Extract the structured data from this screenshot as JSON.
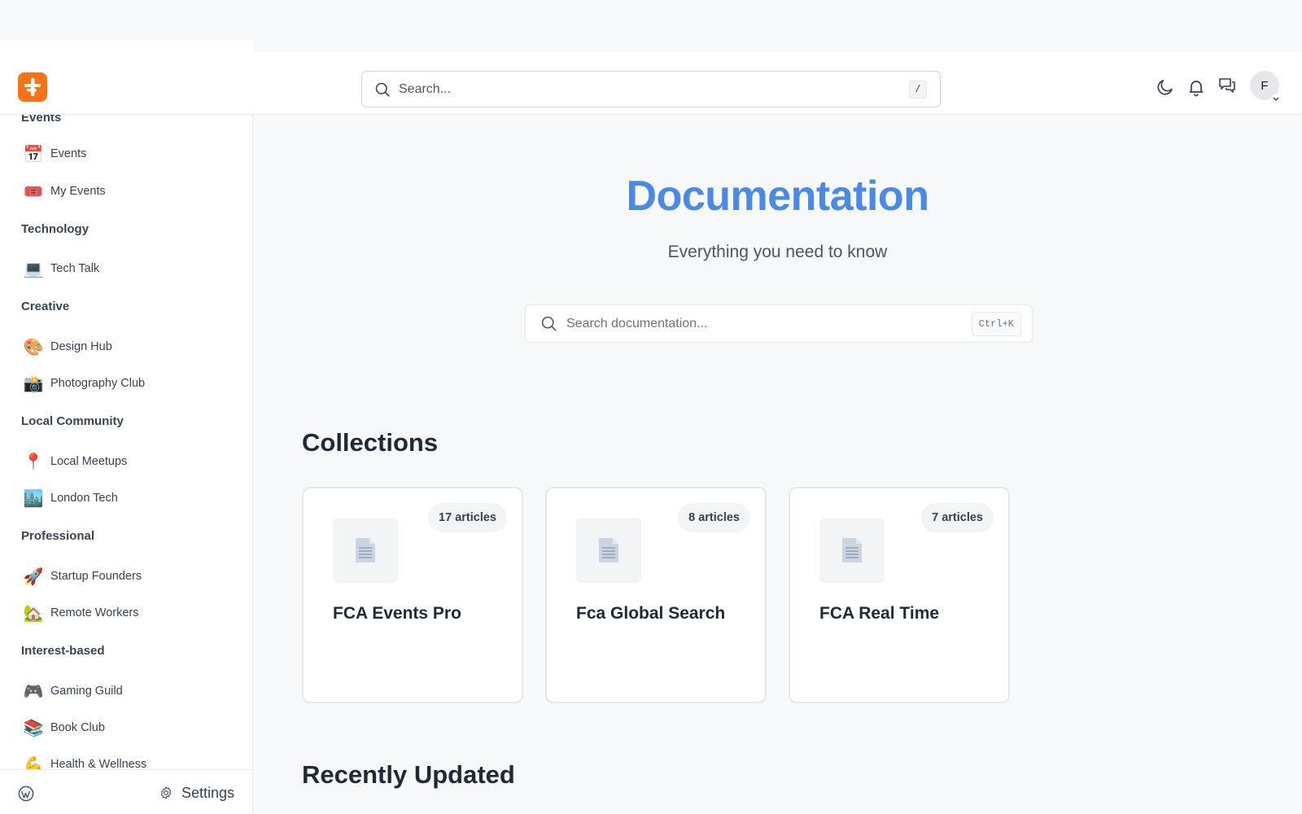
{
  "header": {
    "search_placeholder": "Search...",
    "search_shortcut": "/",
    "avatar_initial": "F",
    "icons": [
      "moon-icon",
      "bell-icon",
      "chat-icon"
    ]
  },
  "sidebar": {
    "groups": [
      {
        "title": "Events",
        "items": [
          {
            "icon": "📅",
            "label": "Events"
          },
          {
            "icon": "🎟️",
            "label": "My Events"
          }
        ]
      },
      {
        "title": "Technology",
        "items": [
          {
            "icon": "💻",
            "label": "Tech Talk"
          }
        ]
      },
      {
        "title": "Creative",
        "items": [
          {
            "icon": "🎨",
            "label": "Design Hub"
          },
          {
            "icon": "📸",
            "label": "Photography Club"
          }
        ]
      },
      {
        "title": "Local Community",
        "items": [
          {
            "icon": "📍",
            "label": "Local Meetups"
          },
          {
            "icon": "🏙️",
            "label": "London Tech"
          }
        ]
      },
      {
        "title": "Professional",
        "items": [
          {
            "icon": "🚀",
            "label": "Startup Founders"
          },
          {
            "icon": "🏡",
            "label": "Remote Workers"
          }
        ]
      },
      {
        "title": "Interest-based",
        "items": [
          {
            "icon": "🎮",
            "label": "Gaming Guild"
          },
          {
            "icon": "📚",
            "label": "Book Club"
          },
          {
            "icon": "💪",
            "label": "Health & Wellness"
          }
        ]
      }
    ],
    "footer": {
      "settings_label": "Settings"
    }
  },
  "main": {
    "title": "Documentation",
    "subtitle": "Everything you need to know",
    "search_placeholder": "Search documentation...",
    "search_shortcut": "Ctrl+K",
    "collections_title": "Collections",
    "collections": [
      {
        "name": "FCA Events Pro",
        "count": "17 articles"
      },
      {
        "name": "Fca Global Search",
        "count": "8 articles"
      },
      {
        "name": "FCA Real Time",
        "count": "7 articles"
      }
    ],
    "recent_title": "Recently Updated"
  },
  "colors": {
    "accent": "#4a8ae6",
    "logo": "#f97316"
  }
}
